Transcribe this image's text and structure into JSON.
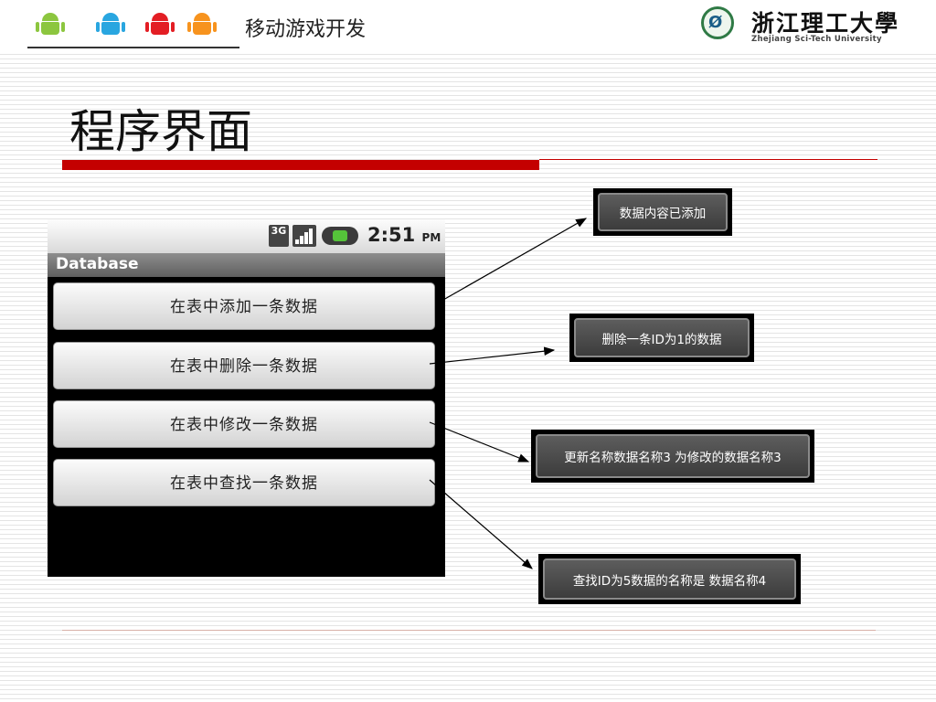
{
  "header": {
    "course_title": "移动游戏开发",
    "university_name": "浙江理工大學",
    "university_name_en": "Zhejiang Sci-Tech University",
    "mascot_colors": [
      "#8cc63f",
      "#29a6e0",
      "#e31e24",
      "#f7931e"
    ]
  },
  "slide": {
    "title": "程序界面"
  },
  "phone": {
    "status_bar": {
      "network": "3G",
      "time": "2:51",
      "ampm": "PM"
    },
    "app_title": "Database",
    "buttons": [
      {
        "label": "在表中添加一条数据"
      },
      {
        "label": "在表中删除一条数据"
      },
      {
        "label": "在表中修改一条数据"
      },
      {
        "label": "在表中查找一条数据"
      }
    ]
  },
  "toasts": [
    {
      "text": "数据内容已添加"
    },
    {
      "text": "删除一条ID为1的数据"
    },
    {
      "text": "更新名称数据名称3 为修改的数据名称3"
    },
    {
      "text": "查找ID为5数据的名称是 数据名称4"
    }
  ],
  "colors": {
    "accent_red": "#c40000",
    "toast_bg": "#4a4a4a"
  }
}
